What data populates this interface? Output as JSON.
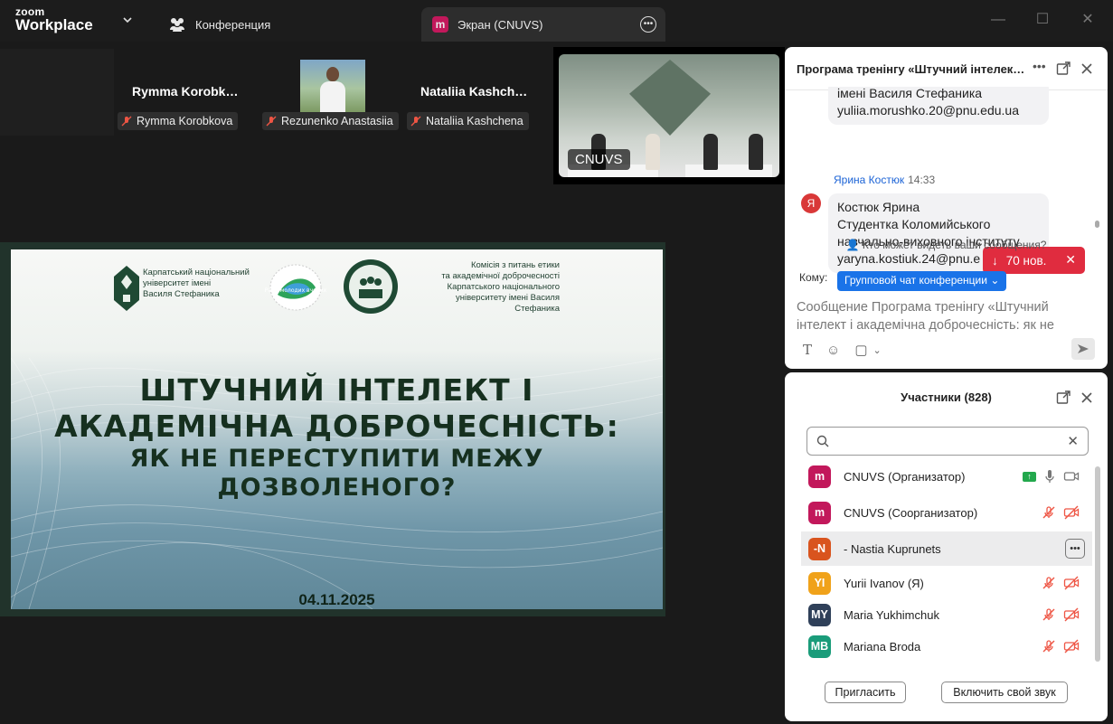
{
  "app": {
    "logo_top": "zoom",
    "logo_bottom": "Workplace"
  },
  "tabs": [
    {
      "label": "Конференция"
    },
    {
      "badge": "m",
      "label": "Экран (CNUVS)"
    }
  ],
  "thumbnails": [
    {
      "name": "Rymma  Korobk…",
      "tag": "Rymma Korobkova"
    },
    {
      "tag": "Rezunenko Anastasiia"
    },
    {
      "name": "Nataliia  Kashch…",
      "tag": "Nataliia Kashchena"
    }
  ],
  "video": {
    "label": "CNUVS"
  },
  "slide": {
    "uni_text": [
      "Карпатський національний",
      "університет імені",
      "Василя Стефаника"
    ],
    "rada_text": "Рада молодих вчених",
    "kom_text": [
      "Комісія з питань етики",
      "та академічної доброчесності",
      "Карпатського національного",
      "університету імені Василя Стефаника"
    ],
    "title_lines": [
      "ШТУЧНИЙ ІНТЕЛЕКТ І",
      "АКАДЕМІЧНА ДОБРОЧЕСНІСТЬ:",
      "ЯК НЕ ПЕРЕСТУПИТИ МЕЖУ",
      "ДОЗВОЛЕНОГО?"
    ],
    "date": "04.11.2025"
  },
  "chat": {
    "title": "Програма тренінгу «Штучний інтелек…",
    "msg1_lines": [
      "імені Василя Стефаника",
      "yuliia.morushko.20@pnu.edu.ua"
    ],
    "sender": "Ярина Костюк",
    "time": "14:33",
    "sender_initial": "Я",
    "msg2_lines": [
      "Костюк Ярина",
      "Студентка Коломийського",
      "навчально-виховного інституту",
      "yaryna.kostiuk.24@pnu.e"
    ],
    "new_badge": "70 нов.",
    "who_sees": "Кто может видеть ваши сообщения?",
    "to_label": "Кому:",
    "to_value": "Групповой чат конференции",
    "composer_lines": [
      "Сообщение Програма тренінгу «Штучний",
      "інтелект і академічна доброчесність:  як не"
    ]
  },
  "participants": {
    "title": "Участники (828)",
    "rows": [
      {
        "initials": "m",
        "color": "#c2185b",
        "name": "CNUVS (Организатор)",
        "state": "active"
      },
      {
        "initials": "m",
        "color": "#c2185b",
        "name": "CNUVS (Соорганизатор)",
        "state": "muted"
      },
      {
        "initials": "-N",
        "color": "#d9541e",
        "name": "- Nastia Kuprunets",
        "state": "hover"
      },
      {
        "initials": "YI",
        "color": "#f0a21a",
        "name": "Yurii Ivanov (Я)",
        "state": "muted"
      },
      {
        "initials": "MY",
        "color": "#2f4059",
        "name": "Maria Yukhimchuk",
        "state": "muted"
      },
      {
        "initials": "MB",
        "color": "#1a9c7a",
        "name": "Mariana Broda",
        "state": "muted"
      }
    ],
    "invite_label": "Пригласить",
    "unmute_label": "Включить свой звук"
  }
}
